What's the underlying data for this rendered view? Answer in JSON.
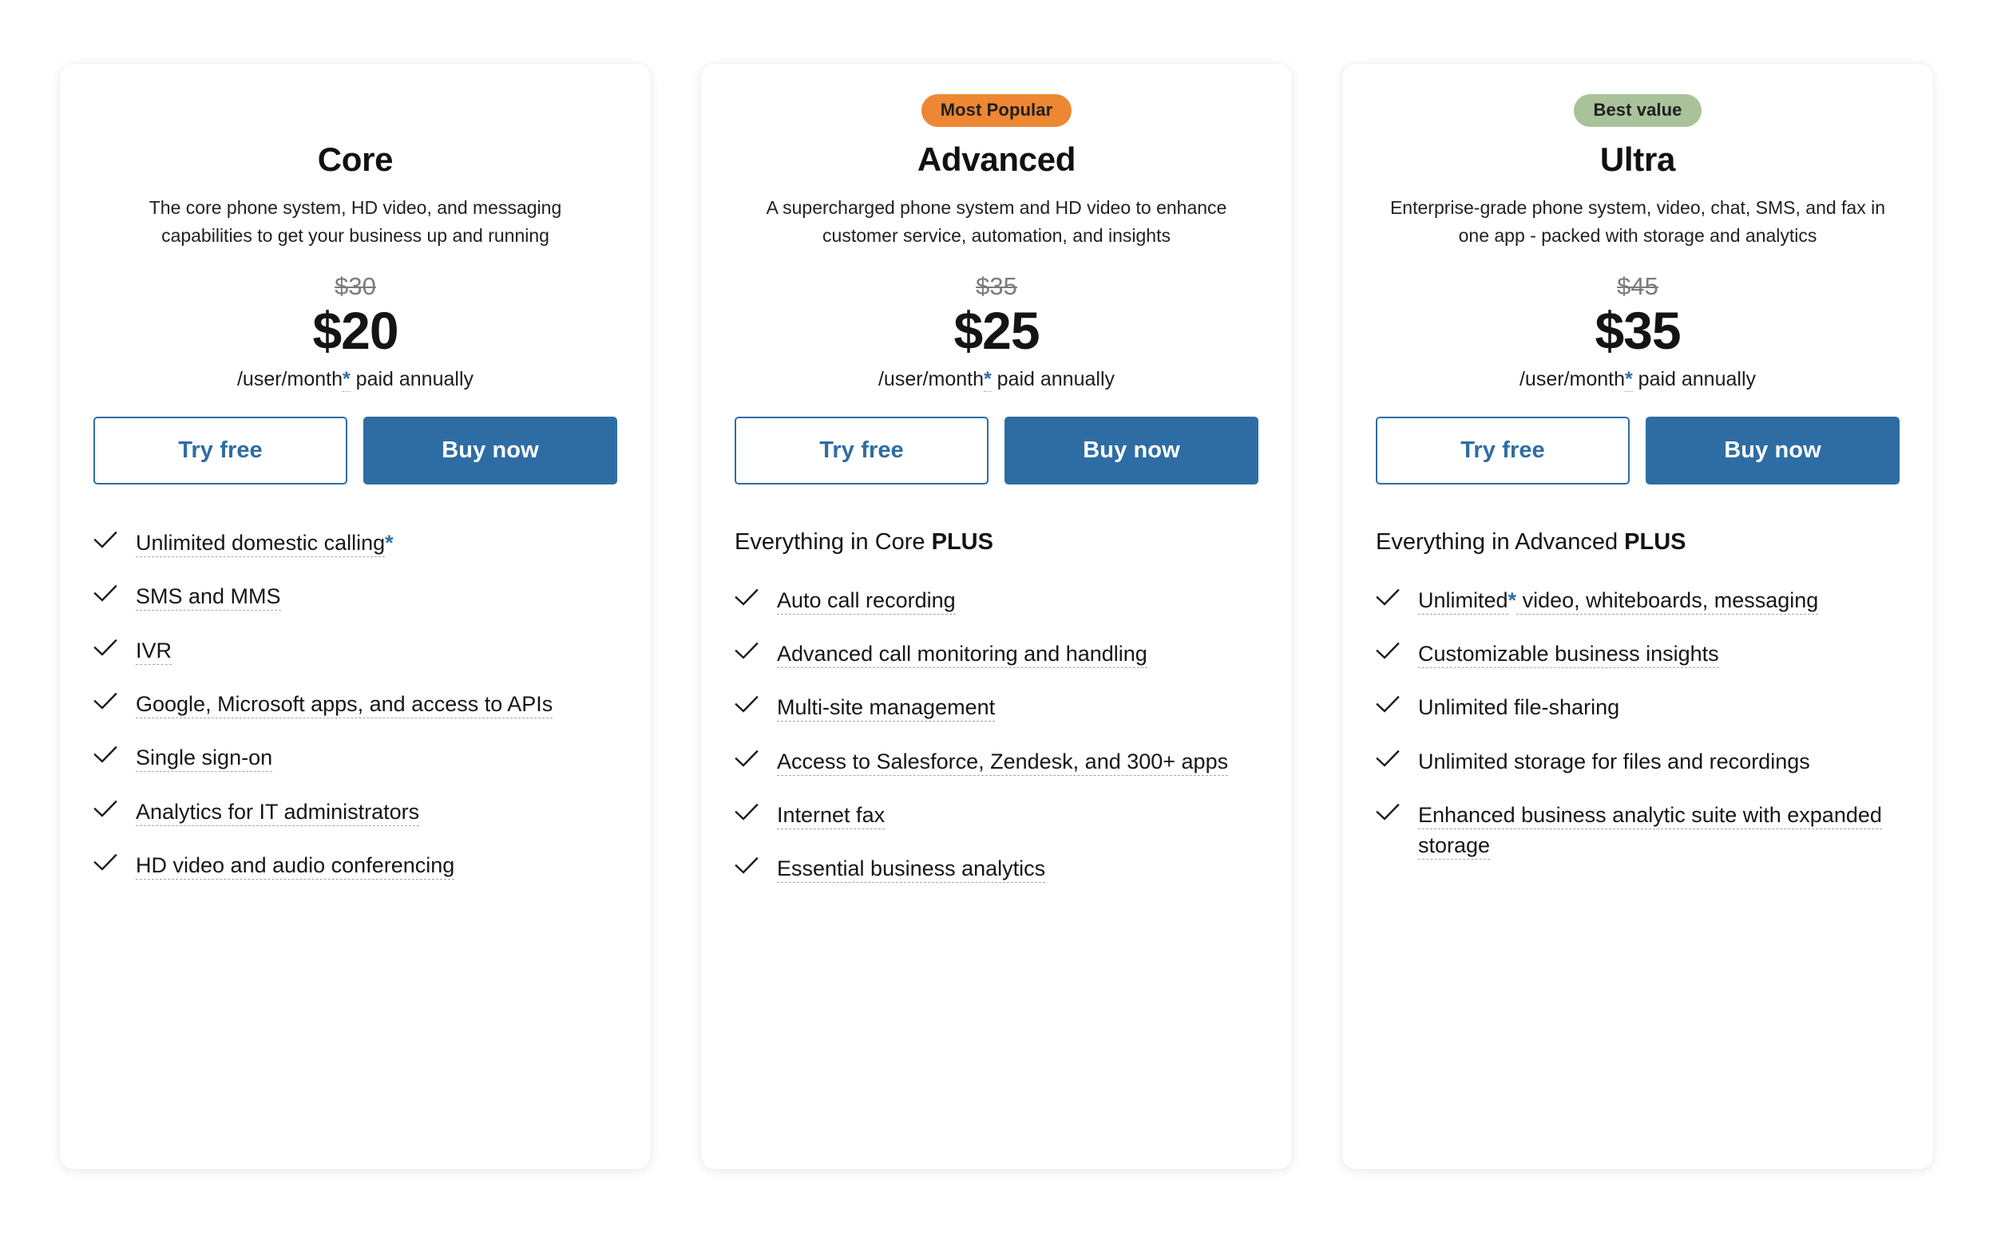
{
  "colors": {
    "accent_blue": "#2E6DA4",
    "badge_popular_bg": "#ED8733",
    "badge_value_bg": "#A9C29A",
    "card_bg": "#FFFFFF",
    "page_bg": "#FFFFFF",
    "strikethrough_text": "#7B7B7B"
  },
  "common": {
    "try_free_label": "Try free",
    "buy_now_label": "Buy now",
    "price_note_prefix": "/user/month",
    "price_note_asterisk": "*",
    "price_note_suffix": " paid annually",
    "check_icon": "check-icon"
  },
  "plans": [
    {
      "badge": "",
      "badge_style": "empty",
      "name": "Core",
      "description": "The core phone system, HD video, and messaging capabilities to get your business up and running",
      "price_old": "$30",
      "price_new": "$20",
      "everything_prefix": "",
      "everything_bold": "",
      "has_everything_line": false,
      "features": [
        {
          "text": "Unlimited domestic calling",
          "underline": true,
          "asterisk": true
        },
        {
          "text": "SMS and MMS",
          "underline": true,
          "asterisk": false
        },
        {
          "text": "IVR",
          "underline": true,
          "asterisk": false
        },
        {
          "text": "Google, Microsoft apps, and access to APIs",
          "underline": true,
          "asterisk": false
        },
        {
          "text": "Single sign-on",
          "underline": true,
          "asterisk": false
        },
        {
          "text": "Analytics for IT administrators",
          "underline": true,
          "asterisk": false
        },
        {
          "text": "HD video and audio conferencing",
          "underline": true,
          "asterisk": false
        }
      ]
    },
    {
      "badge": "Most Popular",
      "badge_style": "popular",
      "name": "Advanced",
      "description": "A supercharged phone system and HD video to enhance customer service, automation, and insights",
      "price_old": "$35",
      "price_new": "$25",
      "everything_prefix": "Everything in Core ",
      "everything_bold": "PLUS",
      "has_everything_line": true,
      "features": [
        {
          "text": "Auto call recording",
          "underline": true,
          "asterisk": false
        },
        {
          "text": "Advanced call monitoring and handling",
          "underline": true,
          "asterisk": false
        },
        {
          "text": "Multi-site management",
          "underline": true,
          "asterisk": false
        },
        {
          "text": "Access to Salesforce, Zendesk, and 300+ apps",
          "underline": true,
          "asterisk": false
        },
        {
          "text": "Internet fax",
          "underline": true,
          "asterisk": false
        },
        {
          "text": "Essential business analytics",
          "underline": true,
          "asterisk": false
        }
      ]
    },
    {
      "badge": "Best value",
      "badge_style": "value",
      "name": "Ultra",
      "description": "Enterprise-grade phone system, video, chat, SMS, and fax in one app - packed with storage and analytics",
      "price_old": "$45",
      "price_new": "$35",
      "everything_prefix": "Everything in Advanced ",
      "everything_bold": "PLUS",
      "has_everything_line": true,
      "features": [
        {
          "text": "Unlimited",
          "text_after": " video, whiteboards, messaging",
          "underline": true,
          "asterisk": true,
          "split": true
        },
        {
          "text": "Customizable business insights",
          "underline": true,
          "asterisk": false
        },
        {
          "text": "Unlimited file-sharing",
          "underline": false,
          "asterisk": false
        },
        {
          "text": "Unlimited storage for files and recordings",
          "underline": false,
          "asterisk": false
        },
        {
          "text": "Enhanced business analytic suite with expanded storage",
          "underline": true,
          "asterisk": false
        }
      ]
    }
  ]
}
